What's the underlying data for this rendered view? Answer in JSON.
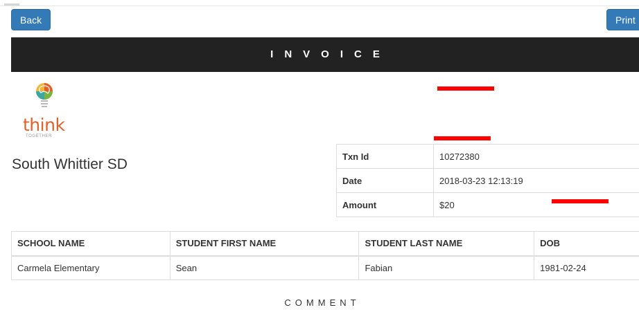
{
  "toolbar": {
    "back_label": "Back",
    "print_label": "Print"
  },
  "banner": {
    "title": "INVOICE"
  },
  "logo": {
    "wordmark": "think",
    "tagline": "TOGETHER"
  },
  "district": "South Whittier SD",
  "transaction": [
    {
      "label": "Txn Id",
      "value": "10272380"
    },
    {
      "label": "Date",
      "value": "2018-03-23 12:13:19"
    },
    {
      "label": "Amount",
      "value": "$20"
    }
  ],
  "students": {
    "headers": [
      "SCHOOL NAME",
      "STUDENT FIRST NAME",
      "STUDENT LAST NAME",
      "DOB"
    ],
    "rows": [
      [
        "Carmela Elementary",
        "Sean",
        "Fabian",
        "1981-02-24"
      ]
    ]
  },
  "comment_heading": "COMMENT",
  "colors": {
    "primary_button": "#337ab7",
    "banner_bg": "#222222",
    "redaction": "#ff0000",
    "logo_text": "#e0622b"
  }
}
